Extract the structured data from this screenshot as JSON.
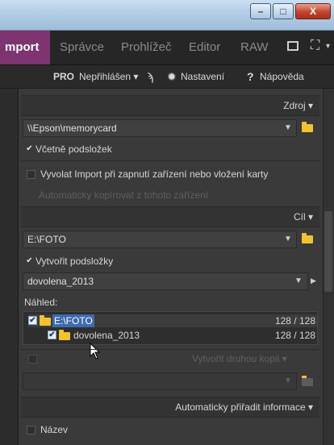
{
  "window": {
    "min_label": "–",
    "max_label": "□",
    "close_label": "X"
  },
  "menu": {
    "tabs": [
      "mport",
      "Správce",
      "Prohlížeč",
      "Editor",
      "RAW"
    ],
    "active_color": "#7d3470"
  },
  "toolbar": {
    "pro": "PRO",
    "login": "Nepřihlášen ▾",
    "settings": "Nastavení",
    "help_mark": "?",
    "help": "Nápověda"
  },
  "source": {
    "header": "Zdroj",
    "path": "\\\\Epson\\memorycard",
    "include_subfolders": "Včetně podsložek",
    "include_subfolders_checked": true,
    "auto_import": "Vyvolat Import při zapnutí zařízení nebo vložení karty",
    "auto_copy": "Automaticky kopírovat z tohoto zařízení"
  },
  "target": {
    "header": "Cíl",
    "path": "E:\\FOTO",
    "create_subfolders": "Vytvořit podsložky",
    "create_subfolders_checked": true,
    "subfolder_name": "dovolena_2013",
    "preview_label": "Náhled:",
    "tree": [
      {
        "name": "E:\\FOTO",
        "count": "128 / 128"
      },
      {
        "name": "dovolena_2013",
        "count": "128 / 128"
      }
    ],
    "second_copy": "Vytvořit druhou kopii"
  },
  "metadata": {
    "header": "Automaticky přiřadit informace",
    "name_label": "Název"
  }
}
